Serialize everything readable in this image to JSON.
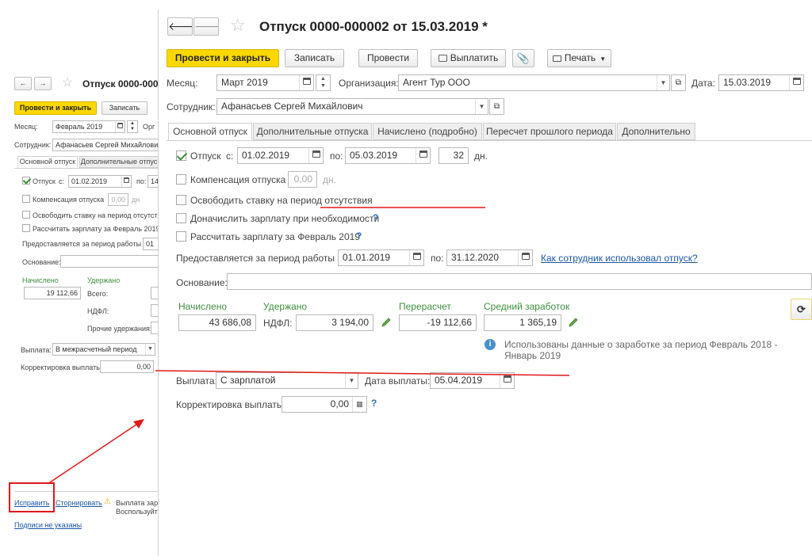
{
  "left": {
    "title": "Отпуск 0000-000",
    "buttons": {
      "post_close": "Провести и закрыть",
      "save": "Записать"
    },
    "month_label": "Месяц:",
    "month_value": "Февраль 2019",
    "org_label": "Орг",
    "employee_label": "Сотрудник:",
    "employee_value": "Афанасьев Сергей Михайлович",
    "tabs": [
      "Основной отпуск",
      "Дополнительные отпус"
    ],
    "vacation_label": "Отпуск",
    "from_label": "с:",
    "from_value": "01.02.2019",
    "to_label": "по:",
    "to_value": "14",
    "compensation_label": "Компенсация отпуска",
    "compensation_value": "0,00",
    "compensation_unit": "дн",
    "free_rate_label": "Освободить ставку на период отсутств",
    "calc_salary_label": "Рассчитать зарплату за Февраль 2019",
    "period_label": "Предоставляется за период работы с:",
    "period_value": "01",
    "basis_label": "Основание:",
    "accrued_label": "Начислено",
    "accrued_value": "19 112,66",
    "withheld_label": "Удержано",
    "total_label": "Всего:",
    "ndfl_label": "НДФЛ:",
    "other_label": "Прочие удержания:",
    "payment_label": "Выплата:",
    "payment_value": "В межрасчетный период",
    "correction_label": "Корректировка выплаты:",
    "correction_value": "0,00",
    "fix_link": "Исправить",
    "storno_link": "Сторнировать",
    "warning_text_1": "Выплата зар",
    "warning_text_2": "Воспользуйт",
    "signatures_link": "Подписи не указаны"
  },
  "main": {
    "title": "Отпуск 0000-000002 от 15.03.2019 *",
    "buttons": {
      "post_close": "Провести и закрыть",
      "save": "Записать",
      "post": "Провести",
      "pay": "Выплатить",
      "print": "Печать"
    },
    "month_label": "Месяц:",
    "month_value": "Март 2019",
    "org_label": "Организация:",
    "org_value": "Агент Тур ООО",
    "date_label": "Дата:",
    "date_value": "15.03.2019",
    "employee_label": "Сотрудник:",
    "employee_value": "Афанасьев Сергей Михайлович",
    "tabs": [
      "Основной отпуск",
      "Дополнительные отпуска",
      "Начислено (подробно)",
      "Пересчет прошлого периода",
      "Дополнительно"
    ],
    "vacation_label": "Отпуск",
    "from_label": "с:",
    "from_value": "01.02.2019",
    "to_label": "по:",
    "to_value": "05.03.2019",
    "days_value": "32",
    "days_unit": "дн.",
    "compensation_label": "Компенсация отпуска",
    "compensation_value": "0,00",
    "compensation_unit": "дн.",
    "free_rate_label": "Освободить ставку на период отсутствия",
    "accrue_salary_label": "Доначислить зарплату при необходимости",
    "calc_salary_label": "Рассчитать зарплату за Февраль 2019",
    "period_label": "Предоставляется за период работы с:",
    "period_from": "01.01.2019",
    "period_to_label": "по:",
    "period_to": "31.12.2020",
    "how_used_link": "Как сотрудник использовал отпуск?",
    "basis_label": "Основание:",
    "accrued_label": "Начислено",
    "accrued_value": "43 686,08",
    "withheld_label": "Удержано",
    "ndfl_label": "НДФЛ:",
    "ndfl_value": "3 194,00",
    "recalc_label": "Перерасчет",
    "recalc_value": "-19 112,66",
    "avg_label": "Средний заработок",
    "avg_value": "1 365,19",
    "info_text_1": "Использованы данные о заработке за период Февраль 2018 -",
    "info_text_2": "Январь 2019",
    "payment_label": "Выплата:",
    "payment_value": "С зарплатой",
    "payment_date_label": "Дата выплаты:",
    "payment_date_value": "05.04.2019",
    "correction_label": "Корректировка выплаты:",
    "correction_value": "0,00",
    "question_mark": "?"
  },
  "colors": {
    "accent_yellow": "#fcd800",
    "link_blue": "#1a56a8",
    "green_label": "#3f8f3f",
    "annotation_red": "#e01818"
  }
}
